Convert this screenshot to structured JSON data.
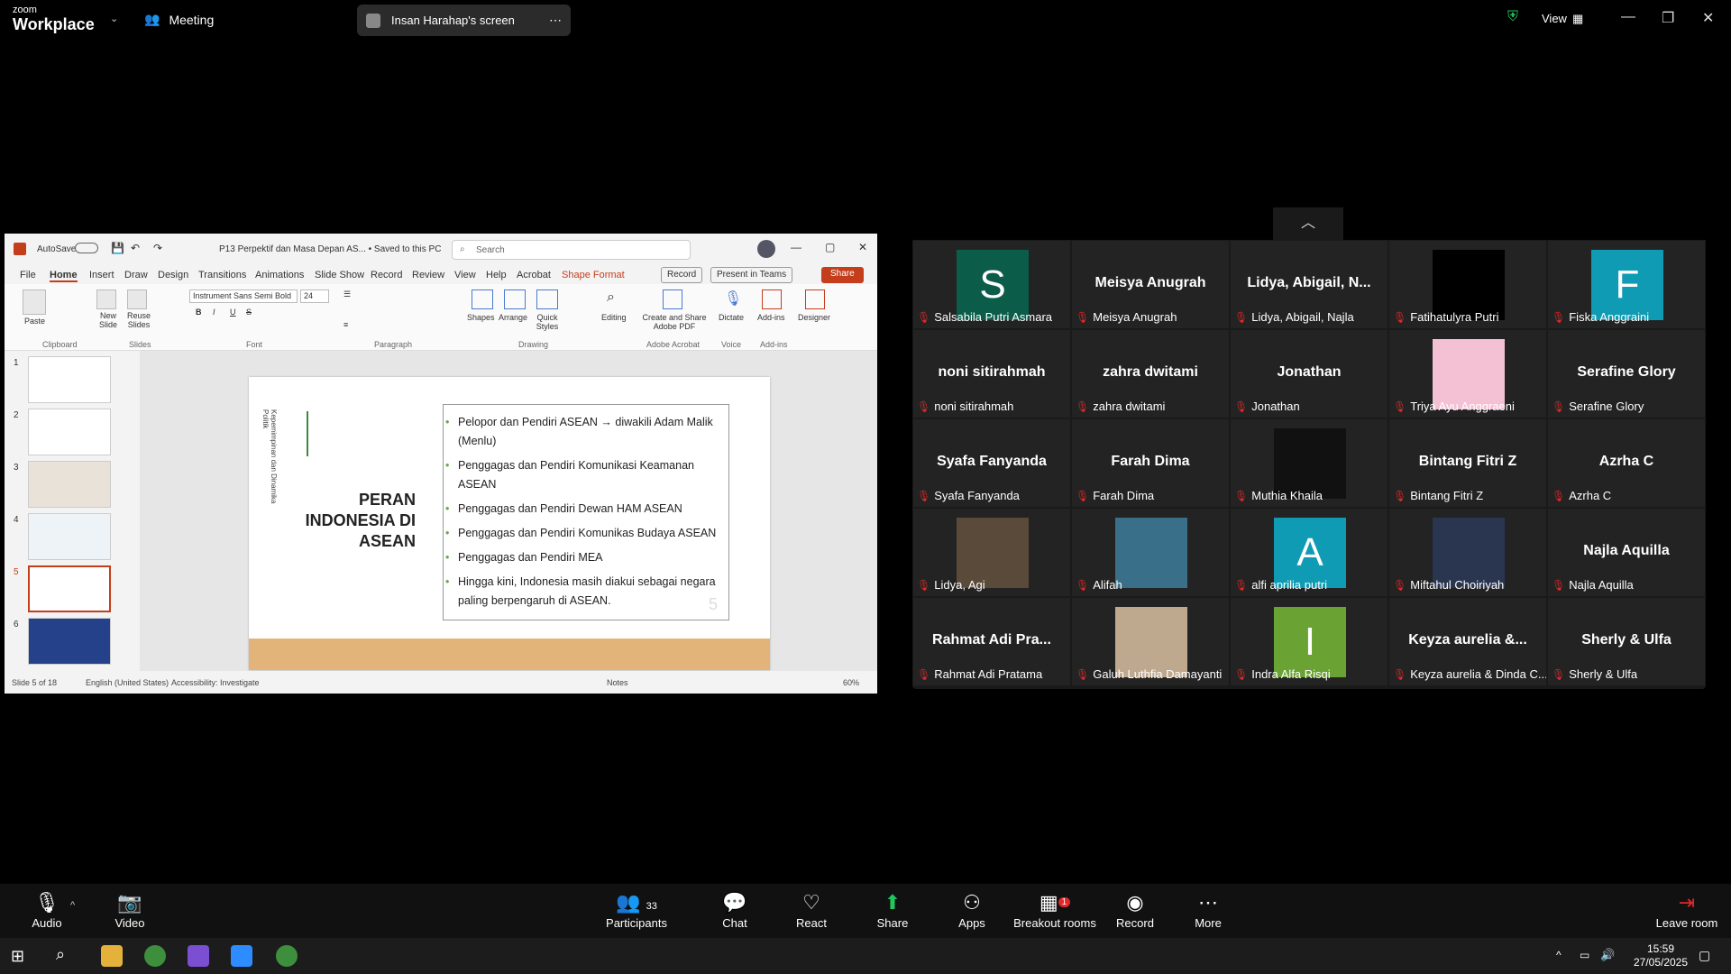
{
  "zoom": {
    "brand_top": "zoom",
    "brand_bottom": "Workplace",
    "meeting_label": "Meeting",
    "screen_share_label": "Insan Harahap's screen",
    "view_label": "View"
  },
  "powerpoint": {
    "autosave": "AutoSave",
    "file_title": "P13 Perpektif dan Masa Depan AS... • Saved to this PC",
    "search_placeholder": "Search",
    "tabs": [
      "File",
      "Home",
      "Insert",
      "Draw",
      "Design",
      "Transitions",
      "Animations",
      "Slide Show",
      "Record",
      "Review",
      "View",
      "Help",
      "Acrobat",
      "Shape Format"
    ],
    "record_btn": "Record",
    "present_btn": "Present in Teams",
    "share_btn": "Share",
    "ribbon": {
      "paste": "Paste",
      "clipboard": "Clipboard",
      "new_slide": "New Slide",
      "reuse_slides": "Reuse Slides",
      "slides": "Slides",
      "font_name": "Instrument Sans Semi Bold",
      "font_size": "24",
      "font": "Font",
      "paragraph": "Paragraph",
      "shapes": "Shapes",
      "arrange": "Arrange",
      "quick_styles": "Quick Styles",
      "drawing": "Drawing",
      "editing": "Editing",
      "create_share": "Create and Share Adobe PDF",
      "adobe_acrobat": "Adobe Acrobat",
      "dictate": "Dictate",
      "voice": "Voice",
      "addins": "Add-ins",
      "addins_group": "Add-ins",
      "designer": "Designer"
    },
    "thumb_numbers": [
      "1",
      "2",
      "3",
      "4",
      "5",
      "6"
    ],
    "slide": {
      "vertical_text": "Kepemimpinan dan Dinamika Politik",
      "title": "PERAN INDONESIA DI ASEAN",
      "bullets": [
        "Pelopor dan Pendiri ASEAN → diwakili Adam Malik (Menlu)",
        "Penggagas dan Pendiri Komunikasi Keamanan ASEAN",
        "Penggagas dan Pendiri Dewan HAM ASEAN",
        "Penggagas dan Pendiri Komunikas Budaya ASEAN",
        "Penggagas dan Pendiri MEA",
        "Hingga kini, Indonesia masih diakui sebagai negara paling berpengaruh di ASEAN."
      ],
      "page_num": "5"
    },
    "status": {
      "slide_of": "Slide 5 of 18",
      "language": "English (United States)",
      "accessibility": "Accessibility: Investigate",
      "notes": "Notes",
      "zoom": "60%"
    }
  },
  "participants": [
    {
      "big": "",
      "avatar": "S",
      "color": "#0b5d4a",
      "name": "Salsabila Putri Asmara"
    },
    {
      "big": "Meisya Anugrah",
      "avatar": "",
      "color": "",
      "name": "Meisya Anugrah"
    },
    {
      "big": "Lidya, Abigail, N...",
      "avatar": "",
      "color": "",
      "name": "Lidya, Abigail, Najla"
    },
    {
      "big": "",
      "avatar": "",
      "color": "#000000",
      "name": "Fatihatulyra Putri"
    },
    {
      "big": "",
      "avatar": "F",
      "color": "#0f9bb3",
      "name": "Fiska Anggraini"
    },
    {
      "big": "noni sitirahmah",
      "avatar": "",
      "color": "",
      "name": "noni sitirahmah"
    },
    {
      "big": "zahra dwitami",
      "avatar": "",
      "color": "",
      "name": "zahra dwitami"
    },
    {
      "big": "Jonathan",
      "avatar": "",
      "color": "",
      "name": "Jonathan"
    },
    {
      "big": "",
      "avatar": "",
      "color": "#f3c1d3",
      "name": "Triya Ayu Anggraeni"
    },
    {
      "big": "Serafine Glory",
      "avatar": "",
      "color": "",
      "name": "Serafine Glory"
    },
    {
      "big": "Syafa Fanyanda",
      "avatar": "",
      "color": "",
      "name": "Syafa Fanyanda"
    },
    {
      "big": "Farah Dima",
      "avatar": "",
      "color": "",
      "name": "Farah Dima"
    },
    {
      "big": "",
      "avatar": "",
      "color": "#111111",
      "name": "Muthia Khaila"
    },
    {
      "big": "Bintang Fitri Z",
      "avatar": "",
      "color": "",
      "name": "Bintang Fitri Z"
    },
    {
      "big": "Azrha C",
      "avatar": "",
      "color": "",
      "name": "Azrha C"
    },
    {
      "big": "",
      "avatar": "",
      "color": "#5a4a3a",
      "name": "Lidya, Agi"
    },
    {
      "big": "",
      "avatar": "",
      "color": "#3a6f8a",
      "name": "Alifah"
    },
    {
      "big": "",
      "avatar": "A",
      "color": "#0f9bb3",
      "name": "alfi aprilia putri"
    },
    {
      "big": "",
      "avatar": "",
      "color": "#2a3550",
      "name": "Miftahul Choiriyah"
    },
    {
      "big": "Najla Aquilla",
      "avatar": "",
      "color": "",
      "name": "Najla Aquilla"
    },
    {
      "big": "Rahmat Adi Pra...",
      "avatar": "",
      "color": "",
      "name": "Rahmat Adi Pratama"
    },
    {
      "big": "",
      "avatar": "",
      "color": "#bfa98e",
      "name": "Galuh Luthfia Damayanti"
    },
    {
      "big": "",
      "avatar": "I",
      "color": "#6aa233",
      "name": "Indra Alfa Risqi"
    },
    {
      "big": "Keyza aurelia &...",
      "avatar": "",
      "color": "",
      "name": "Keyza aurelia & Dinda C..."
    },
    {
      "big": "Sherly & Ulfa",
      "avatar": "",
      "color": "",
      "name": "Sherly & Ulfa"
    }
  ],
  "toolbar": {
    "audio": "Audio",
    "video": "Video",
    "participants": "Participants",
    "participants_count": "33",
    "chat": "Chat",
    "react": "React",
    "share": "Share",
    "apps": "Apps",
    "breakout": "Breakout rooms",
    "breakout_badge": "1",
    "record": "Record",
    "more": "More",
    "leave": "Leave room"
  },
  "taskbar": {
    "time": "15:59",
    "date": "27/05/2025"
  }
}
